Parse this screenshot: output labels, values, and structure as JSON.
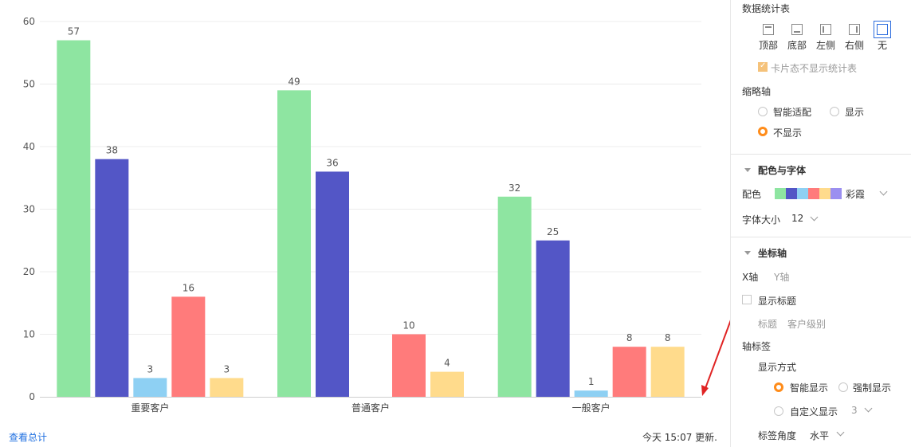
{
  "chart_data": {
    "type": "bar",
    "categories": [
      "重要客户",
      "普通客户",
      "一般客户"
    ],
    "series": [
      {
        "values": [
          57,
          49,
          32
        ],
        "color": "#8ee5a1"
      },
      {
        "values": [
          38,
          36,
          25
        ],
        "color": "#5356c6"
      },
      {
        "values": [
          3,
          null,
          1
        ],
        "color": "#8ed0f3"
      },
      {
        "values": [
          16,
          10,
          8
        ],
        "color": "#ff7b7b"
      },
      {
        "values": [
          3,
          4,
          8
        ],
        "color": "#ffdb8c"
      }
    ],
    "data_labels": [
      [
        "57",
        "38",
        "3",
        "16",
        "3"
      ],
      [
        "49",
        "36",
        "",
        "10",
        "4"
      ],
      [
        "32",
        "25",
        "1",
        "8",
        "8"
      ]
    ],
    "yticks": [
      "0",
      "10",
      "20",
      "30",
      "40",
      "50",
      "60"
    ],
    "ylim": [
      0,
      60
    ],
    "grid": true,
    "title": "",
    "xlabel": "",
    "ylabel": ""
  },
  "footer": {
    "link": "查看总计",
    "status": "今天 15:07 更新."
  },
  "annotation": {
    "arrow_color": "#e02424"
  },
  "panel": {
    "stats_table": {
      "title": "数据统计表",
      "positions": [
        "顶部",
        "底部",
        "左侧",
        "右侧",
        "无"
      ],
      "selected": "无",
      "card_hide_label": "卡片态不显示统计表",
      "card_hide_checked": true
    },
    "thumbnail_axis": {
      "title": "缩略轴",
      "options": [
        "智能适配",
        "显示",
        "不显示"
      ],
      "selected": "不显示"
    },
    "color_font": {
      "title": "配色与字体",
      "color_label": "配色",
      "palette": [
        "#8ee5a1",
        "#5356c6",
        "#8ed0f3",
        "#ff7b7b",
        "#ffdb8c",
        "#9b8ff0"
      ],
      "palette_name": "彩霞",
      "font_size_label": "字体大小",
      "font_size": "12"
    },
    "axis": {
      "title": "坐标轴",
      "tab_x": "X轴",
      "tab_y": "Y轴",
      "show_title_label": "显示标题",
      "show_title_checked": false,
      "title_field_label": "标题",
      "title_field_placeholder": "客户级别",
      "axis_label_title": "轴标签",
      "display_mode_label": "显示方式",
      "mode_options": [
        "智能显示",
        "强制显示",
        "自定义显示"
      ],
      "mode_selected": "智能显示",
      "custom_value": "3",
      "label_angle_label": "标签角度",
      "label_angle": "水平"
    }
  }
}
